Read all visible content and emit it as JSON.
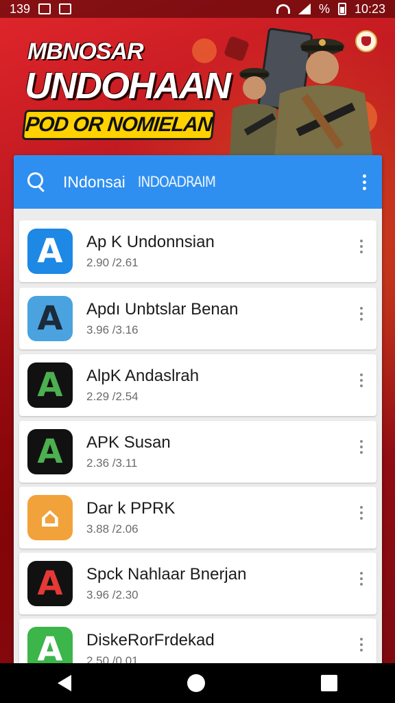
{
  "status_bar": {
    "time_left": "139",
    "time_right": "10:23",
    "battery_text": "%"
  },
  "banner": {
    "title_line1": "MBNOSAR",
    "title_line2": "UNDOHAAN",
    "tagline": "POD OR NOMIELAN"
  },
  "search": {
    "query": "INdonsai",
    "hint": "INDOADRAIM"
  },
  "apps": [
    {
      "name": "Ap K Undonnsian",
      "meta": "2.90 /2.61",
      "icon": "a-letter-icon",
      "icon_bg": "#1e88e5",
      "icon_fg": "#ffffff"
    },
    {
      "name": "Apdı Unbtslar Benan",
      "meta": "3.96 /3.16",
      "icon": "dark-a-letter-icon",
      "icon_bg": "#4aa3df",
      "icon_fg": "#1c2a3a"
    },
    {
      "name": "AlpK Andaslrah",
      "meta": "2.29 /2.54",
      "icon": "a-letter-icon",
      "icon_bg": "#111111",
      "icon_fg": "#4caf50"
    },
    {
      "name": "APK Susan",
      "meta": "2.36 /3.11",
      "icon": "a-letter-icon",
      "icon_bg": "#111111",
      "icon_fg": "#4caf50"
    },
    {
      "name": "Dar k PPRK",
      "meta": "3.88 /2.06",
      "icon": "house-icon",
      "icon_bg": "#f2a23a",
      "icon_fg": "#ffffff"
    },
    {
      "name": "Spck Nahlaar Bnerjan",
      "meta": "3.96 /2.30",
      "icon": "a-letter-icon",
      "icon_bg": "#111111",
      "icon_fg": "#e53935"
    },
    {
      "name": "DiskeRorFrdekad",
      "meta": "2.50 /0.01",
      "icon": "a-letter-icon",
      "icon_bg": "#3cb54a",
      "icon_fg": "#ffffff"
    }
  ]
}
